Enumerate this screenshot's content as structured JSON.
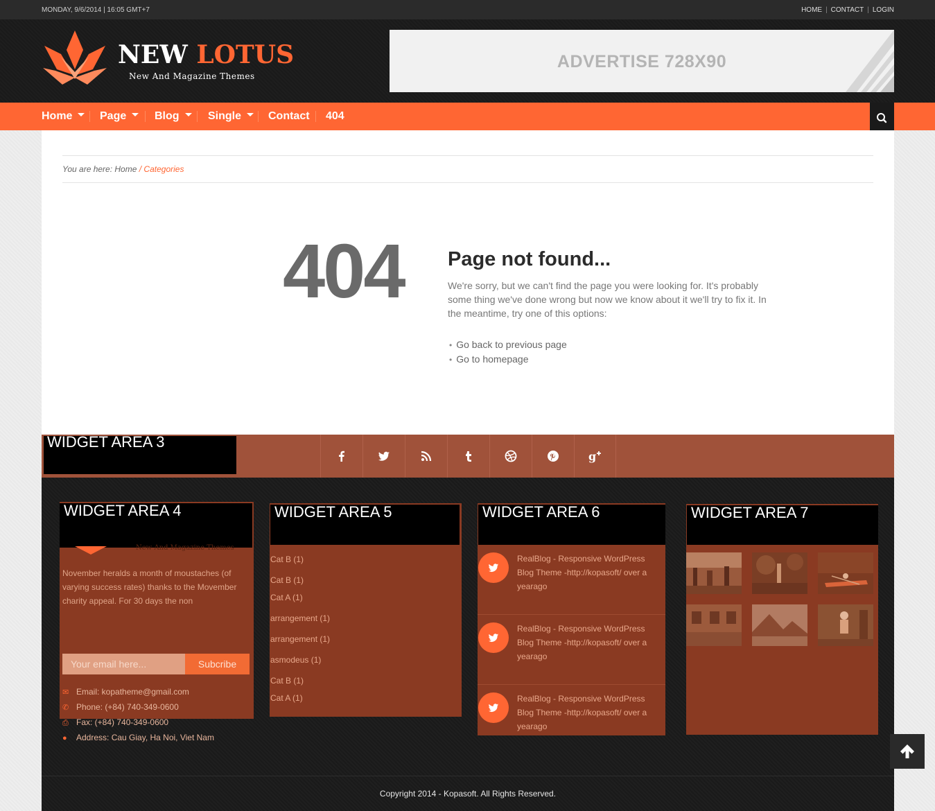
{
  "topbar": {
    "date": "MONDAY, 9/6/2014 | 16:05 GMT+7",
    "links": [
      "HOME",
      "CONTACT",
      "LOGIN"
    ]
  },
  "header": {
    "logo_title_main": "NEW ",
    "logo_title_accent": "LOTUS",
    "logo_subtitle": "New And Magazine Themes",
    "ad_text": "ADVERTISE 728X90"
  },
  "nav": {
    "items": [
      {
        "label": "Home",
        "dropdown": true
      },
      {
        "label": "Page",
        "dropdown": true
      },
      {
        "label": "Blog",
        "dropdown": true
      },
      {
        "label": "Single",
        "dropdown": true
      },
      {
        "label": "Contact",
        "dropdown": false
      },
      {
        "label": "404",
        "dropdown": false
      }
    ],
    "search_icon": "search-icon"
  },
  "breadcrumb": {
    "prefix": "You are here: ",
    "home": "Home",
    "separator": " / ",
    "current": "Categories"
  },
  "not_found": {
    "code": "404",
    "title": "Page not found...",
    "body": "We're sorry, but we can't find the page you were looking for. It's probably some thing we've done wrong but now we know about it we'll try to fix it. In the meantime, try one of this options:",
    "links": [
      "Go back to previous page",
      "Go to homepage"
    ]
  },
  "social": {
    "widget_title": "WIDGET AREA 3",
    "icons": [
      "facebook-icon",
      "twitter-icon",
      "rss-icon",
      "tumblr-icon",
      "dribbble-icon",
      "pinterest-icon",
      "google-plus-icon"
    ]
  },
  "widget4": {
    "title": "WIDGET AREA 4",
    "logo_subtitle": "New And Magazine Themes",
    "about": "November heralds a month of moustaches (of varying success rates) thanks to the Movember charity appeal. For 30 days the non",
    "email_placeholder": "Your email here...",
    "subscribe_label": "Subcribe",
    "email": "Email: kopatheme@gmail.com",
    "phone": "Phone: (+84) 740-349-0600",
    "fax": "Fax: (+84) 740-349-0600",
    "address": "Address: Cau Giay, Ha Noi, Viet Nam"
  },
  "widget5": {
    "title": "WIDGET AREA 5",
    "categories": [
      "Cat B (1)",
      "Cat B (1)",
      "Cat A (1)",
      "arrangement (1)",
      "arrangement (1)",
      "asmodeus (1)",
      "Cat B (1)",
      "Cat A (1)"
    ]
  },
  "widget6": {
    "title": "WIDGET AREA 6",
    "tweets": [
      "RealBlog - Responsive WordPress Blog Theme -http://kopasoft/ over a yearago",
      "RealBlog - Responsive WordPress Blog Theme -http://kopasoft/ over a yearago",
      "RealBlog - Responsive WordPress Blog Theme -http://kopasoft/ over a yearago"
    ]
  },
  "widget7": {
    "title": "WIDGET AREA 7"
  },
  "footer": {
    "copyright": "Copyright 2014 - Kopasoft. All Rights Reserved."
  },
  "colors": {
    "accent": "#ff6633",
    "dark": "#1c1c1c",
    "widget_bg": "#8a3a22"
  }
}
